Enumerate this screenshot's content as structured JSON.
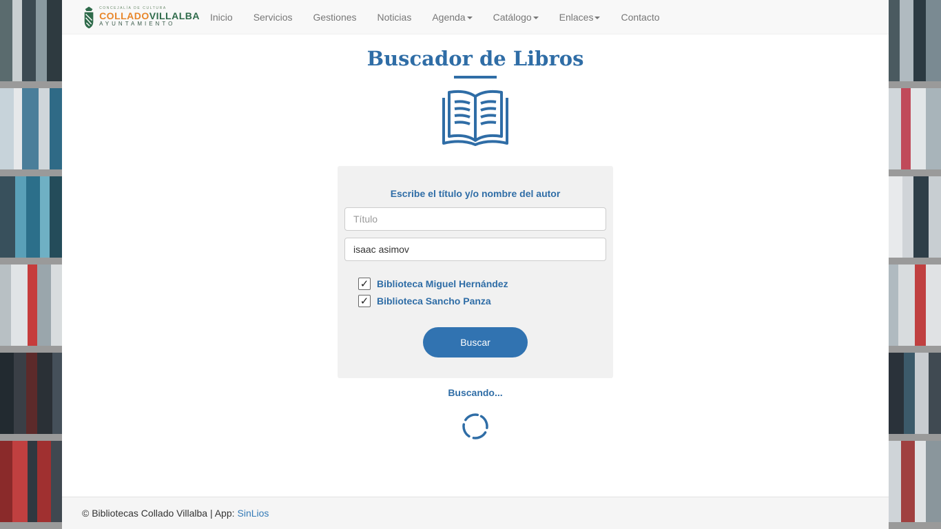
{
  "logo": {
    "small": "CONCEJALÍA DE CULTURA",
    "brand_a": "COLLADO",
    "brand_b": "VILLALBA",
    "ayto": "AYUNTAMIENTO"
  },
  "nav": {
    "items": [
      {
        "label": "Inicio"
      },
      {
        "label": "Servicios"
      },
      {
        "label": "Gestiones"
      },
      {
        "label": "Noticias"
      },
      {
        "label": "Agenda"
      },
      {
        "label": "Catálogo"
      },
      {
        "label": "Enlaces"
      },
      {
        "label": "Contacto"
      }
    ]
  },
  "main": {
    "title": "Buscador de Libros",
    "icon": "open-book-icon",
    "form": {
      "label": "Escribe el título y/o nombre del autor",
      "title_placeholder": "Título",
      "title_value": "",
      "author_value": "isaac asimov",
      "libraries": [
        {
          "label": "Biblioteca Miguel Hernández",
          "checked": true
        },
        {
          "label": "Biblioteca Sancho Panza",
          "checked": true
        }
      ],
      "search_label": "Buscar"
    },
    "status": "Buscando..."
  },
  "footer": {
    "text": "© Bibliotecas Collado Villalba | App:",
    "link": "SinLios"
  },
  "colors": {
    "accent": "#2f6da6",
    "button": "#3173b1",
    "brand_orange": "#e8862a",
    "brand_green": "#2f6b4b"
  }
}
